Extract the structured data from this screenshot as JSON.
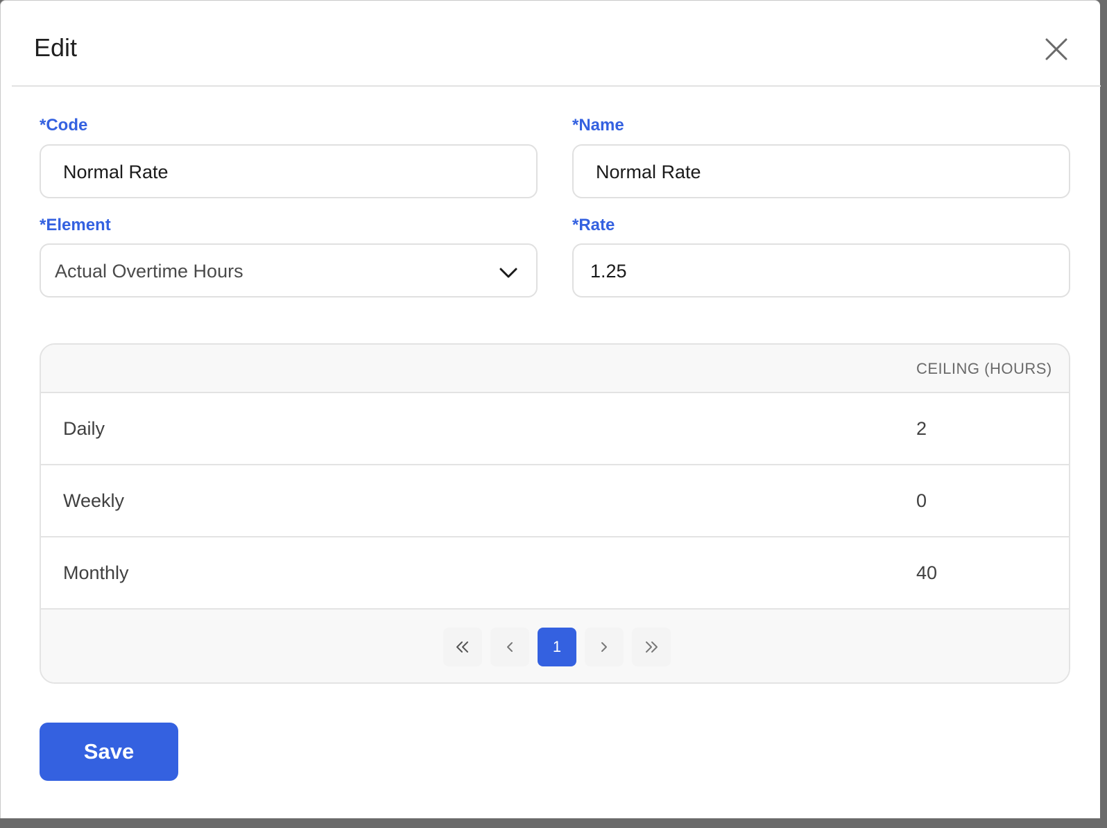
{
  "dialog": {
    "title": "Edit"
  },
  "form": {
    "code": {
      "label": "*Code",
      "value": "Normal Rate"
    },
    "name": {
      "label": "*Name",
      "value": "Normal Rate"
    },
    "element": {
      "label": "*Element",
      "value": "Actual Overtime Hours"
    },
    "rate": {
      "label": "*Rate",
      "value": "1.25"
    }
  },
  "table": {
    "columns": [
      "",
      "CEILING (HOURS)"
    ],
    "rows": [
      {
        "period": "Daily",
        "ceiling": "2"
      },
      {
        "period": "Weekly",
        "ceiling": "0"
      },
      {
        "period": "Monthly",
        "ceiling": "40"
      }
    ]
  },
  "pagination": {
    "current_page": "1"
  },
  "actions": {
    "save_label": "Save"
  },
  "colors": {
    "accent": "#3461E0",
    "label": "#3461E0",
    "border": "#E3E3E3"
  },
  "icons": {
    "close": "close-icon",
    "select": "chevron-down-icon",
    "first": "double-chevron-left-icon",
    "prev": "chevron-left-icon",
    "next": "chevron-right-icon",
    "last": "double-chevron-right-icon"
  }
}
